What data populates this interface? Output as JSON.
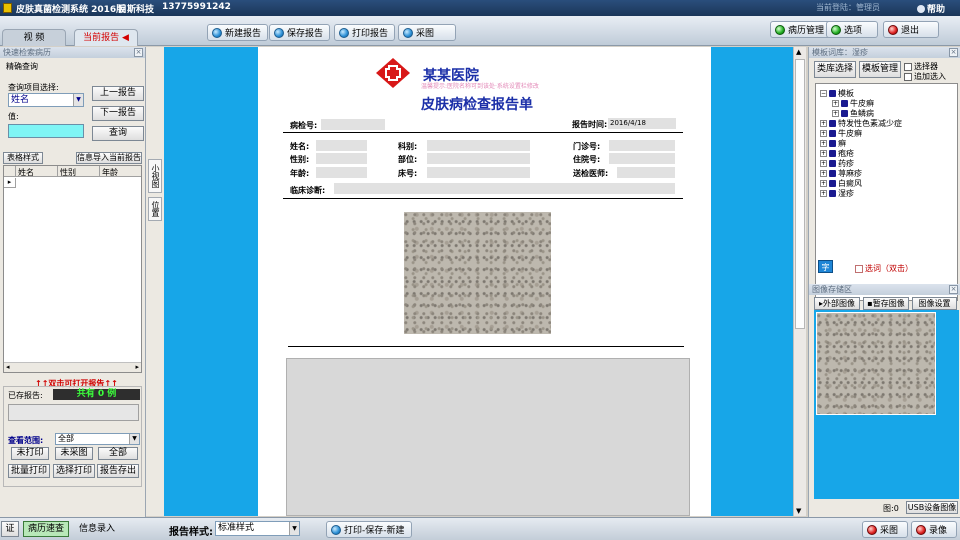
{
  "titlebar": {
    "app_name": "皮肤真菌检测系统 2016版",
    "company": "目斯科技",
    "phone": "13775991242",
    "login_info": "当前登陆：管理员",
    "help": "帮助"
  },
  "tabs": [
    {
      "label": "视 频",
      "active": false
    },
    {
      "label": "当前报告 ◀",
      "active": true
    }
  ],
  "toolbar": {
    "new_report": "新建报告",
    "save_report": "保存报告",
    "print_report": "打印报告",
    "capture": "采图",
    "records": "病历管理",
    "options": "选项",
    "exit": "退出"
  },
  "left": {
    "quick_search_header": "快速检索病历",
    "exact_query": "精确查询",
    "query_item_label": "查询项目选择:",
    "query_item_value": "姓名",
    "value_label": "值:",
    "prev_report": "上一报告",
    "next_report": "下一报告",
    "query_btn": "查询",
    "table_style": "表格样式",
    "import_info": "信息导入当前报告",
    "columns": [
      "姓名",
      "性别",
      "年龄"
    ],
    "dblclick_hint": "↑↑双击可打开报告↑↑",
    "saved_reports_label": "已存报告:",
    "saved_count": "共有 0 例",
    "view_range_label": "查看范围:",
    "view_range_value": "全部",
    "not_printed": "未打印",
    "not_captured": "未采图",
    "all": "全部",
    "batch_print": "批量打印",
    "select_print": "选择打印",
    "export": "报告存出"
  },
  "side_tabs": [
    "小视图",
    "位置"
  ],
  "report": {
    "hospital": "某某医院",
    "hint": "温馨提示:医院名称可到该处·系统设置栏修改",
    "title": "皮肤病检查报告单",
    "exam_no_label": "病检号:",
    "report_time_label": "报告时间:",
    "report_time": "2016/4/18",
    "name_label": "姓名:",
    "dept_label": "科别:",
    "clinic_no_label": "门诊号:",
    "sex_label": "性别:",
    "site_label": "部位:",
    "inpatient_no_label": "住院号:",
    "age_label": "年龄:",
    "bed_label": "床号:",
    "doctor_label": "送检医师:",
    "diagnosis_label": "临床诊断:"
  },
  "right": {
    "template_header": "模板词库：湿疹",
    "lib_select": "类库选择",
    "template_manage": "模板管理",
    "opt_selector": "选择器",
    "opt_append": "追加选入",
    "tree": [
      {
        "label": "模板",
        "level": 0,
        "expand": "-"
      },
      {
        "label": "牛皮癣",
        "level": 1,
        "expand": "+"
      },
      {
        "label": "鱼鳞病",
        "level": 1,
        "expand": "+"
      },
      {
        "label": "特发性色素减少症",
        "level": 0,
        "expand": "+"
      },
      {
        "label": "牛皮癣",
        "level": 0,
        "expand": "+"
      },
      {
        "label": "癣",
        "level": 0,
        "expand": "+"
      },
      {
        "label": "疱疮",
        "level": 0,
        "expand": "+"
      },
      {
        "label": "药疹",
        "level": 0,
        "expand": "+"
      },
      {
        "label": "荨麻疹",
        "level": 0,
        "expand": "+"
      },
      {
        "label": "白癜风",
        "level": 0,
        "expand": "+"
      },
      {
        "label": "湿疹",
        "level": 0,
        "expand": "+"
      }
    ],
    "word_btn": "字",
    "select_dblclick": "选词（双击）",
    "image_header": "图像存储区",
    "external_image": "外部图像",
    "temp_image": "暂存图像",
    "image_settings": "图像设置",
    "image_count": "图:0",
    "usb_image": "USB设备图像"
  },
  "statusbar": {
    "cert": "证",
    "record_query": "病历速查",
    "info_entry": "信息录入",
    "report_style_label": "报告样式:",
    "report_style_value": "标准样式",
    "print_save_new": "打印-保存-新建",
    "capture": "采图",
    "record": "录像"
  }
}
